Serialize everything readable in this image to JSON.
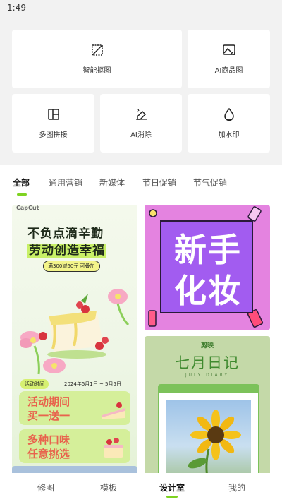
{
  "status_bar": {
    "time": "1:49"
  },
  "tools": [
    {
      "label": "智能抠图",
      "icon": "smart-cutout-icon"
    },
    {
      "label": "AI商品图",
      "icon": "ai-product-image-icon"
    },
    {
      "label": "多图拼接",
      "icon": "multi-image-collage-icon"
    },
    {
      "label": "AI消除",
      "icon": "ai-eraser-icon"
    },
    {
      "label": "加水印",
      "icon": "watermark-icon"
    }
  ],
  "tabs": [
    {
      "label": "全部",
      "active": true
    },
    {
      "label": "通用营销",
      "active": false
    },
    {
      "label": "新媒体",
      "active": false
    },
    {
      "label": "节日促销",
      "active": false
    },
    {
      "label": "节气促销",
      "active": false
    }
  ],
  "templates": {
    "left": {
      "brand": "CapCut",
      "headline_line1": "不负点滴辛勤",
      "headline_line2": "劳动创造幸福",
      "offer": "满300减60元 可叠加",
      "activity_label": "活动时间",
      "date_range": "2024年5月1日 ~ 5月5日",
      "promo1": [
        "活动期间",
        "买一送一"
      ],
      "promo2": [
        "多种口味",
        "任意挑选"
      ]
    },
    "right_top": {
      "line1": "新手",
      "line2": "化妆"
    },
    "right_bottom": {
      "brand": "剪映",
      "title": "七月日记",
      "subtitle": "JULY DIARY"
    }
  },
  "bottom_nav": [
    {
      "label": "修图",
      "active": false
    },
    {
      "label": "模板",
      "active": false
    },
    {
      "label": "设计室",
      "active": true
    },
    {
      "label": "我的",
      "active": false
    }
  ],
  "colors": {
    "accent_green": "#7ed321",
    "page_gray": "#f2f2f2",
    "makeup_bg": "#e483e0",
    "makeup_board": "#a25cf0",
    "diary_bg": "#c4d9a8"
  }
}
